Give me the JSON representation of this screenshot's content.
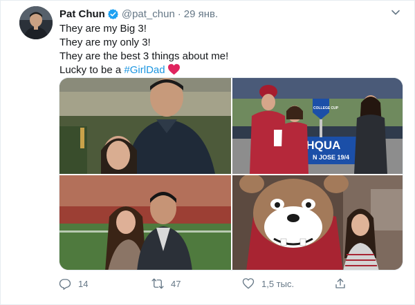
{
  "tweet": {
    "author_name": "Pat Chun",
    "handle": "@pat_chun",
    "separator": "·",
    "date": "29 янв.",
    "lines": [
      "They are my Big 3!",
      "They are my only 3!",
      "They are the best 3 things about me!"
    ],
    "last_line_prefix": "Lucky to be a ",
    "hashtag": "#GirlDad",
    "photo_text": {
      "banner_left": "THQUA",
      "banner_right": "N JOSE 19/4",
      "trophy": "COLLEGE CUP"
    }
  },
  "actions": {
    "reply_count": "14",
    "retweet_count": "47",
    "like_count": "1,5 тыс."
  },
  "colors": {
    "link": "#1b95e0",
    "muted": "#657786",
    "heart": "#e0245e",
    "verified": "#1da1f2"
  },
  "icons": {
    "verified": "verified-badge-icon",
    "caret": "chevron-down-icon",
    "reply": "reply-icon",
    "retweet": "retweet-icon",
    "like": "heart-outline-icon",
    "share": "share-icon"
  }
}
